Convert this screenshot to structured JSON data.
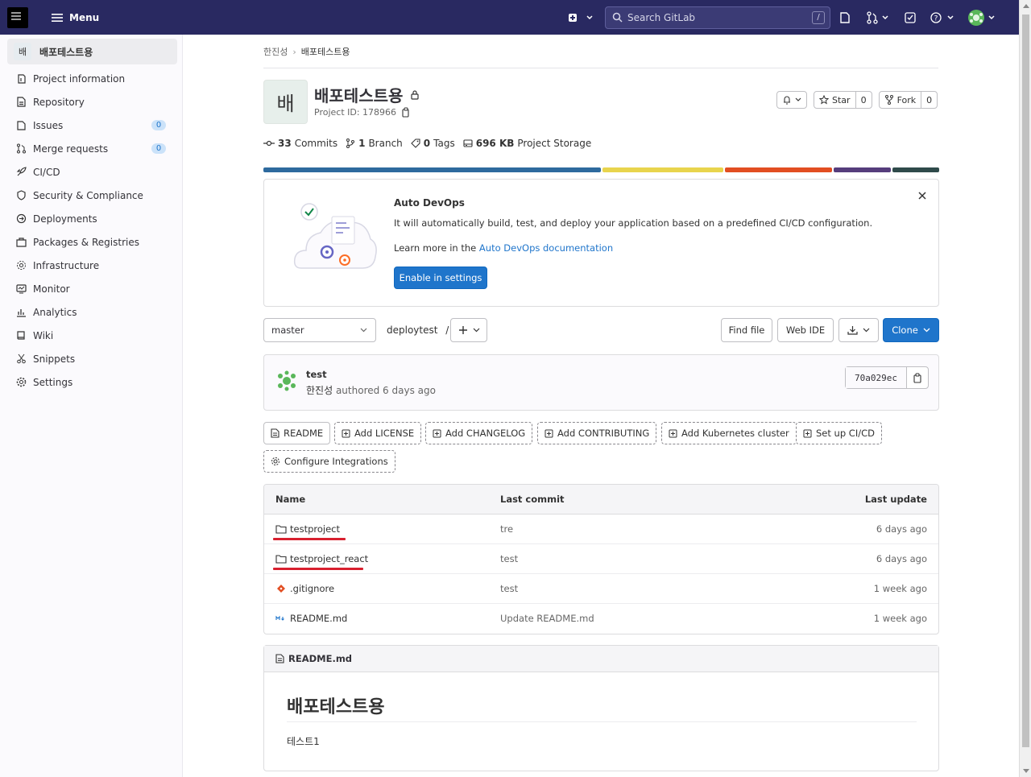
{
  "topbar": {
    "menu_label": "Menu",
    "search_placeholder": "Search GitLab",
    "search_shortcut": "/"
  },
  "sidebar": {
    "project_avatar": "배",
    "project_name": "배포테스트용",
    "items": [
      {
        "label": "Project information",
        "icon": "info-icon"
      },
      {
        "label": "Repository",
        "icon": "doc-icon"
      },
      {
        "label": "Issues",
        "icon": "issues-icon",
        "badge": "0"
      },
      {
        "label": "Merge requests",
        "icon": "merge-icon",
        "badge": "0"
      },
      {
        "label": "CI/CD",
        "icon": "rocket-icon"
      },
      {
        "label": "Security & Compliance",
        "icon": "shield-icon"
      },
      {
        "label": "Deployments",
        "icon": "deploy-icon"
      },
      {
        "label": "Packages & Registries",
        "icon": "package-icon"
      },
      {
        "label": "Infrastructure",
        "icon": "cloud-icon"
      },
      {
        "label": "Monitor",
        "icon": "monitor-icon"
      },
      {
        "label": "Analytics",
        "icon": "chart-icon"
      },
      {
        "label": "Wiki",
        "icon": "book-icon"
      },
      {
        "label": "Snippets",
        "icon": "scissors-icon"
      },
      {
        "label": "Settings",
        "icon": "gear-icon"
      }
    ]
  },
  "breadcrumb": {
    "parent": "한진성",
    "current": "배포테스트용"
  },
  "project": {
    "avatar": "배",
    "name": "배포테스트용",
    "id_text": "Project ID: 178966",
    "star_label": "Star",
    "star_count": "0",
    "fork_label": "Fork",
    "fork_count": "0"
  },
  "stats": {
    "commits_num": "33",
    "commits_label": "Commits",
    "branch_num": "1",
    "branch_label": "Branch",
    "tags_num": "0",
    "tags_label": "Tags",
    "storage_num": "696 KB",
    "storage_label": "Project Storage"
  },
  "language_bar_colors": [
    "#2e6a9e",
    "#e8d44d",
    "#e24e22",
    "#563d7c",
    "#2f4a4a"
  ],
  "devops": {
    "title": "Auto DevOps",
    "description": "It will automatically build, test, and deploy your application based on a predefined CI/CD configuration.",
    "learn_prefix": "Learn more in the ",
    "learn_link": "Auto DevOps documentation",
    "enable_button": "Enable in settings"
  },
  "repo": {
    "branch": "master",
    "path": "deploytest",
    "path_sep": "/",
    "find_file": "Find file",
    "web_ide": "Web IDE",
    "clone": "Clone"
  },
  "commit": {
    "message": "test",
    "author": "한진성",
    "authored_text": "authored 6 days ago",
    "sha": "70a029ec"
  },
  "quick_buttons": [
    "README",
    "Add LICENSE",
    "Add CHANGELOG",
    "Add CONTRIBUTING",
    "Add Kubernetes cluster",
    "Set up CI/CD",
    "Configure Integrations"
  ],
  "files": {
    "headers": {
      "name": "Name",
      "commit": "Last commit",
      "update": "Last update"
    },
    "rows": [
      {
        "name": "testproject",
        "type": "folder",
        "commit": "tre",
        "update": "6 days ago"
      },
      {
        "name": "testproject_react",
        "type": "folder",
        "commit": "test",
        "update": "6 days ago"
      },
      {
        "name": ".gitignore",
        "type": "git",
        "commit": "test",
        "update": "1 week ago"
      },
      {
        "name": "README.md",
        "type": "markdown",
        "commit": "Update README.md",
        "update": "1 week ago"
      }
    ]
  },
  "readme": {
    "filename": "README.md",
    "heading": "배포테스트용",
    "body": "테스트1"
  }
}
